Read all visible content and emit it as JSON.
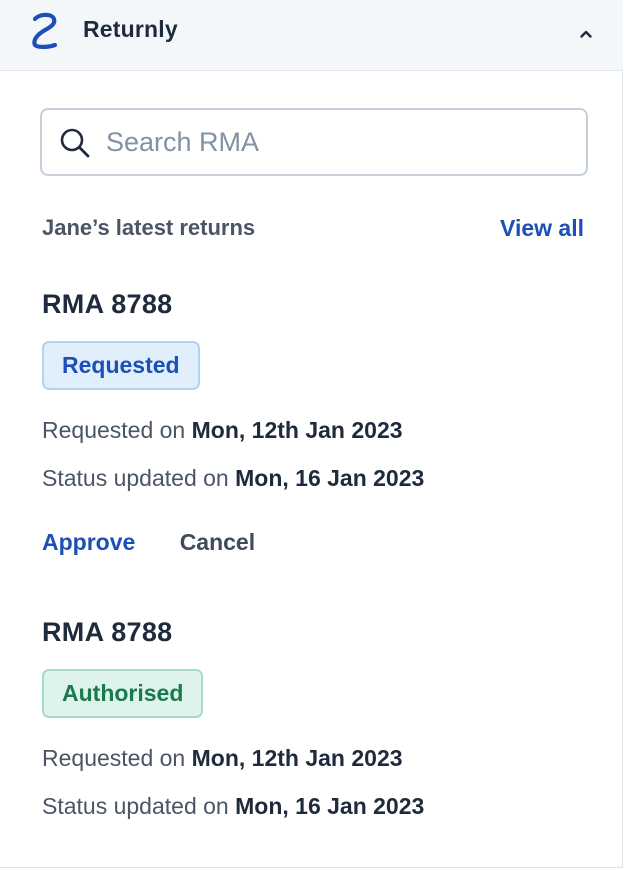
{
  "header": {
    "app_title": "Returnly",
    "logo_icon": "returnly-logo-icon",
    "collapse_icon": "chevron-up-icon"
  },
  "search": {
    "placeholder": "Search RMA",
    "value": ""
  },
  "returns_section": {
    "title": "Jane’s latest returns",
    "view_all_label": "View all"
  },
  "returns": [
    {
      "title": "RMA 8788",
      "status": "Requested",
      "requested_label": "Requested on",
      "requested_date": "Mon, 12th Jan 2023",
      "updated_label": "Status updated on",
      "updated_date": "Mon, 16 Jan 2023",
      "approve_label": "Approve",
      "cancel_label": "Cancel"
    },
    {
      "title": "RMA 8788",
      "status": "Authorised",
      "requested_label": "Requested on",
      "requested_date": "Mon, 12th Jan 2023",
      "updated_label": "Status updated on",
      "updated_date": "Mon, 16 Jan 2023"
    }
  ],
  "colors": {
    "brand": "#1d4fb8",
    "requested_badge_bg": "#e1effd",
    "authorised_badge_bg": "#ddf3ec",
    "authorised_text": "#1b7a4b"
  }
}
